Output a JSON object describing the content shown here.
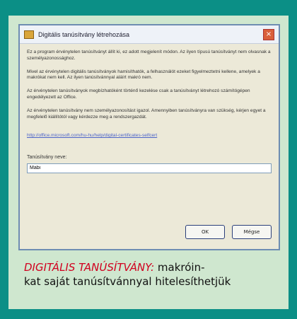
{
  "dialog": {
    "title": "Digitális tanúsítvány létrehozása",
    "close_label": "×",
    "paragraphs": [
      "Ez a program érvénytelen tanúsítványt állít ki, ez adott megjelenít módon. Az ilyen típusú tanúsítványt nem olvasnak a személyazonossághoz.",
      "Mivel az érvénytelen digitális tanúsítványok hamisíthatók, a felhasználót ezeket figyelmeztetni kellene, amelyek a makrókat nem kell. Az ilyen tanúsítvánnyal aláírt makró nem.",
      "Az érvénytelen tanúsítványok megbízhatóként történő kezelése csak a tanúsítványt létrehozó számítógépen engedélyezett az Office.",
      "Az érvénytelen tanúsítvány nem személyazonosítást igazol. Amennyiben tanúsítványra van szükség, kérjen egyet a megfelelő kiállítótól vagy kérdezze meg a rendszergazdát."
    ],
    "link": "http://office.microsoft.com/hu-hu/help/digital-certificates-selfcert",
    "field_label": "Tanúsítvány neve:",
    "field_value": "Mabi",
    "ok_label": "OK",
    "cancel_label": "Mégse"
  },
  "caption": {
    "lead": "DIGITÁLIS TANÚSÍTVÁNY:",
    "line1_rest": " makróin-",
    "line2": "kat saját tanúsítvánnyal hitelesíthetjük"
  }
}
